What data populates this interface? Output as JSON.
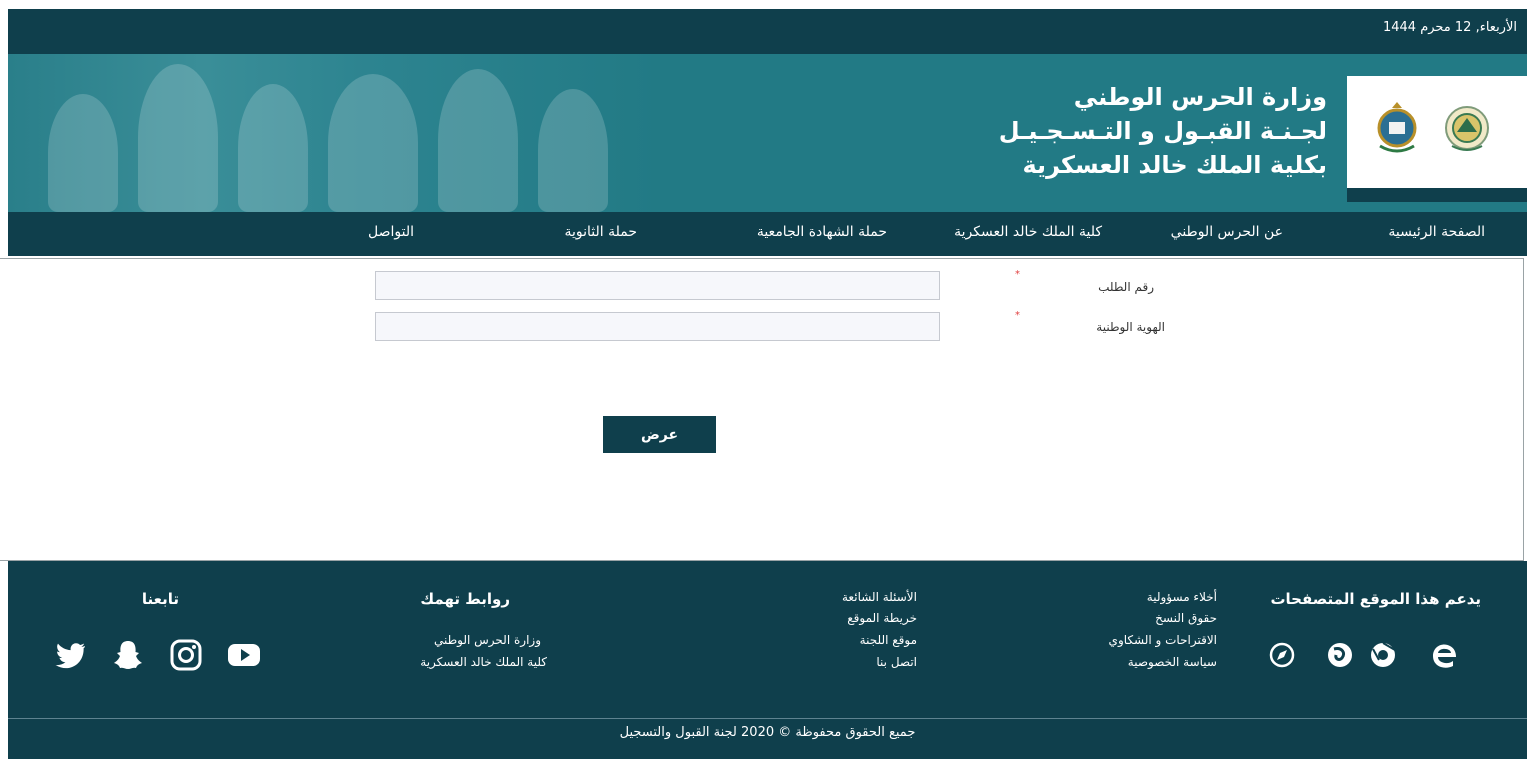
{
  "topbar": {
    "date": "الأربعاء, 12 محرم 1444"
  },
  "banner": {
    "title_line1": "وزارة الحرس الوطني",
    "title_line2": "لجـنـة القبـول و التـسـجـيـل",
    "title_line3": "بكلية الملك خالد العسكرية"
  },
  "nav": {
    "home": "الصفحة الرئيسية",
    "about": "عن الحرس الوطني",
    "college": "كلية الملك خالد العسكرية",
    "university": "حملة الشهادة الجامعية",
    "secondary": "حملة الثانوية",
    "contact": "التواصل"
  },
  "form": {
    "request_label": "رقم الطلب",
    "request_value": "",
    "id_label": "الهوية الوطنية",
    "id_value": "",
    "required_mark": "*",
    "submit": "عرض"
  },
  "footer": {
    "browsers_heading": "يدعم هذا الموقع المتصفحات",
    "links_col1": [
      "أخلاء مسؤولية",
      "حقوق النسخ",
      "الاقتراحات و الشكاوي",
      "سياسة الخصوصية"
    ],
    "links_col2": [
      "الأسئلة الشائعة",
      "خريطة الموقع",
      "موقع اللجنة",
      "اتصل بنا"
    ],
    "related_heading": "روابط تهمك",
    "related_links": [
      "وزارة الحرس الوطني",
      "كلية الملك خالد العسكرية"
    ],
    "follow_heading": "تابعنا",
    "copyright": "جميع الحقوق محفوظة © 2020 لجنة القبول والتسجيل",
    "browser_icons": [
      "edge-icon",
      "chrome-icon",
      "firefox-icon",
      "safari-icon"
    ],
    "social_icons": [
      "youtube-icon",
      "instagram-icon",
      "snapchat-icon",
      "twitter-icon"
    ]
  },
  "colors": {
    "dark_teal": "#0f3f4c",
    "banner_teal": "#227a85",
    "required_red": "#e14040"
  }
}
